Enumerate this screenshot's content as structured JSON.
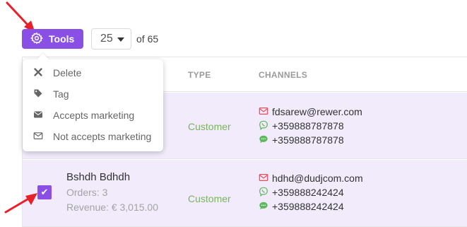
{
  "toolbar": {
    "tools_label": "Tools",
    "page_size": "25",
    "total_text": "of 65"
  },
  "menu": {
    "items": [
      {
        "label": "Delete",
        "icon": "times-icon"
      },
      {
        "label": "Tag",
        "icon": "tag-icon"
      },
      {
        "label": "Accepts marketing",
        "icon": "envelope-icon"
      },
      {
        "label": "Not accepts marketing",
        "icon": "envelope-outline-icon"
      }
    ]
  },
  "table": {
    "columns": {
      "type": "TYPE",
      "channels": "CHANNELS"
    },
    "rows": [
      {
        "type": "Customer",
        "email": "fdsarew@rewer.com",
        "viber": "+359888787878",
        "sms": "+359888787878"
      },
      {
        "name": "Bshdh Bdhdh",
        "orders": "Orders: 3",
        "revenue": "Revenue: € 3,015.00",
        "type": "Customer",
        "email": "hdhd@dudjcom.com",
        "viber": "+359888242424",
        "sms": "+359888242424",
        "checkbox_mark": "✔"
      }
    ]
  },
  "colors": {
    "accent": "#8a50e6",
    "row_highlight": "#f1ebfb",
    "customer_type": "#7ab55c",
    "email_icon": "#e74c5b",
    "viber_icon": "#5cb85c",
    "sms_icon": "#5cb85c",
    "annotation_arrow": "#e8202a"
  }
}
